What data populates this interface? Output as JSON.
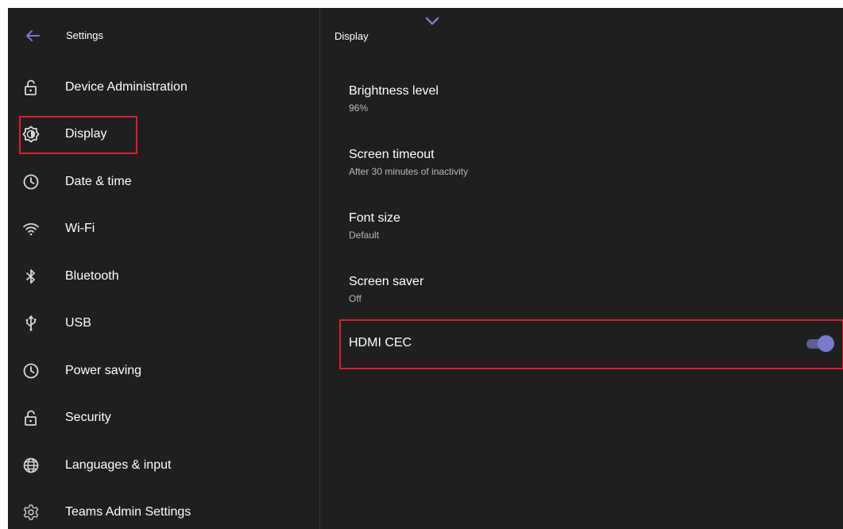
{
  "header": {
    "title": "Settings",
    "back_icon": "arrow-left-icon"
  },
  "sidebar": {
    "items": [
      {
        "label": "Device Administration",
        "icon": "lock-open-icon"
      },
      {
        "label": "Display",
        "icon": "brightness-icon",
        "selected": true
      },
      {
        "label": "Date & time",
        "icon": "clock-icon"
      },
      {
        "label": "Wi-Fi",
        "icon": "wifi-icon"
      },
      {
        "label": "Bluetooth",
        "icon": "bluetooth-icon"
      },
      {
        "label": "USB",
        "icon": "usb-icon"
      },
      {
        "label": "Power saving",
        "icon": "clock-icon"
      },
      {
        "label": "Security",
        "icon": "lock-open-icon"
      },
      {
        "label": "Languages & input",
        "icon": "globe-icon"
      },
      {
        "label": "Teams Admin Settings",
        "icon": "gear-icon"
      }
    ]
  },
  "main": {
    "title": "Display",
    "settings": [
      {
        "title": "Brightness level",
        "value": "96%"
      },
      {
        "title": "Screen timeout",
        "value": "After 30 minutes of inactivity"
      },
      {
        "title": "Font size",
        "value": "Default"
      },
      {
        "title": "Screen saver",
        "value": "Off"
      }
    ],
    "hdmi_cec": {
      "label": "HDMI CEC",
      "enabled": true
    }
  },
  "colors": {
    "background": "#1f1f1f",
    "accent": "#7a79d4",
    "highlight": "#e11d2a",
    "text_primary": "#ffffff",
    "text_secondary": "#b8b8b8"
  }
}
